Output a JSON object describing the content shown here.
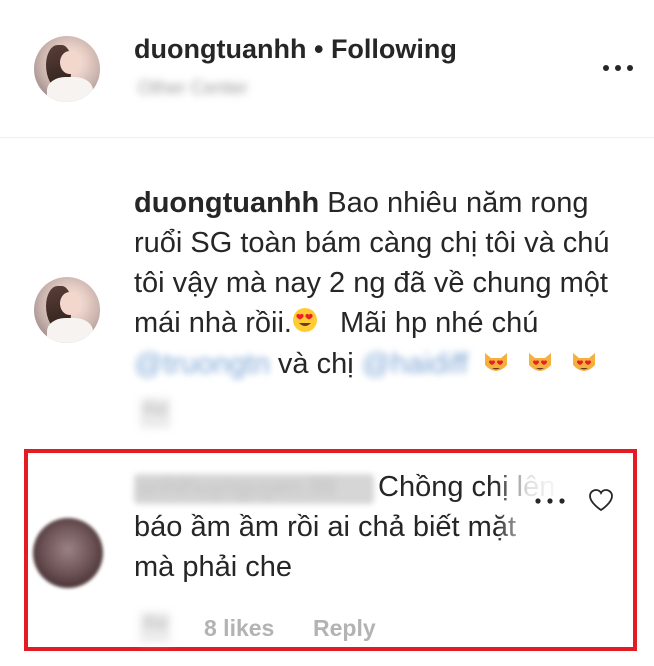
{
  "header": {
    "username": "duongtuanhh",
    "separator": "•",
    "follow_status": "Following",
    "location": "Other Center",
    "more_icon": "more-options-icon"
  },
  "caption": {
    "username": "duongtuanhh",
    "text_line1": "Bao nhiêu năm rong",
    "text_line2": "ruổi SG toàn bám càng chị tôi và chú",
    "text_line3": "tôi vậy mà nay 2 ng đã về chung một",
    "text_line4": "mái nhà rồii.",
    "text_line4b": "Mãi hp nhé chú",
    "mention1": "@truongtn",
    "and_text": "và chị",
    "mention2": "@haidiff",
    "time": "4w",
    "emoji_heart_eyes": "heart-eyes-emoji",
    "emoji_cat": "heart-eyes-cat-emoji"
  },
  "reply_comment": {
    "username": "anhthuynguyen.99",
    "text_line1": "Chồng chị lên",
    "text_line2": "báo ầm ầm rồi ai chả biết mặt",
    "text_line3": "mà phải che",
    "time": "4w",
    "likes": "8 likes",
    "reply_label": "Reply",
    "like_icon": "heart-outline-icon",
    "more_icon": "more-options-icon"
  },
  "colors": {
    "highlight_frame": "#e31b23",
    "text": "#262626",
    "muted": "#b3b3b3"
  }
}
